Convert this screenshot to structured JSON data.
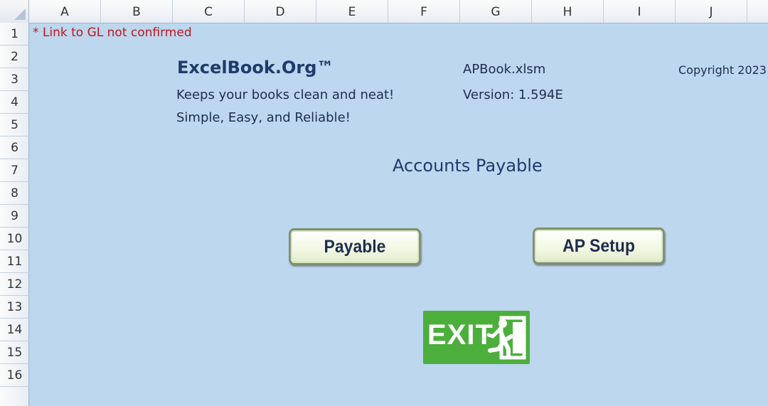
{
  "columns": [
    "A",
    "B",
    "C",
    "D",
    "E",
    "F",
    "G",
    "H",
    "I",
    "J"
  ],
  "rows": [
    "1",
    "2",
    "3",
    "4",
    "5",
    "6",
    "7",
    "8",
    "9",
    "10",
    "11",
    "12",
    "13",
    "14",
    "15",
    "16"
  ],
  "cells": {
    "warning": "* Link to GL not confirmed",
    "brand": "ExcelBook.Org™",
    "tagline1": "Keeps your books clean and neat!",
    "tagline2": "Simple, Easy, and Reliable!",
    "filename": "APBook.xlsm",
    "version": "Version: 1.594E",
    "copyright": "Copyright 2023",
    "section_title": "Accounts Payable"
  },
  "buttons": {
    "payable": "Payable",
    "ap_setup": "AP Setup",
    "exit": "EXIT"
  },
  "icons": {
    "exit": "exit-running-man-icon"
  },
  "colors": {
    "sheet_background": "#bdd7ee",
    "warning_text": "#c0161d",
    "exit_green": "#4caf3c"
  }
}
